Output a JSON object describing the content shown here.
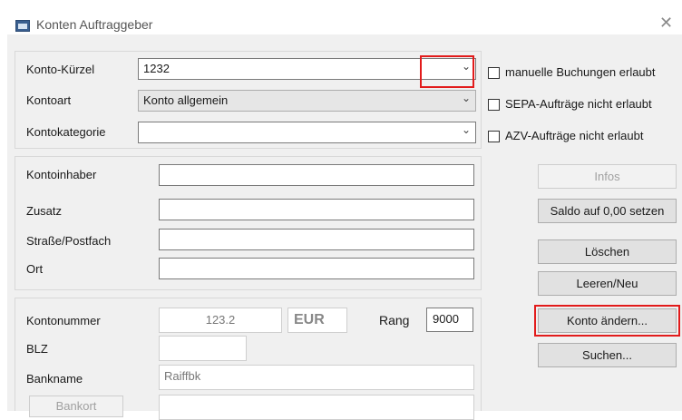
{
  "window": {
    "title": "Konten Auftraggeber",
    "close_glyph": "✕"
  },
  "top": {
    "konto_kuerzel": {
      "label": "Konto-Kürzel",
      "value": "1232"
    },
    "kontoart": {
      "label": "Kontoart",
      "value": "Konto allgemein"
    },
    "kontokategorie": {
      "label": "Kontokategorie",
      "value": ""
    },
    "checkboxes": [
      {
        "label": "manuelle Buchungen erlaubt",
        "checked": false
      },
      {
        "label": "SEPA-Aufträge nicht erlaubt",
        "checked": false
      },
      {
        "label": "AZV-Aufträge nicht erlaubt",
        "checked": false
      }
    ]
  },
  "owner": {
    "kontoinhaber_label": "Kontoinhaber",
    "zusatz_label": "Zusatz",
    "strasse_label": "Straße/Postfach",
    "ort_label": "Ort"
  },
  "account": {
    "kontonummer_label": "Kontonummer",
    "kontonummer_value": "123.2",
    "currency": "EUR",
    "rang_label": "Rang",
    "rang_value": "9000",
    "blz_label": "BLZ",
    "blz_value": "",
    "bankname_label": "Bankname",
    "bankname_value": "Raiffbk",
    "bankort_label": "Bankort"
  },
  "buttons": {
    "infos": "Infos",
    "saldo": "Saldo auf 0,00 setzen",
    "loeschen": "Löschen",
    "leeren": "Leeren/Neu",
    "aendern": "Konto ändern...",
    "suchen": "Suchen..."
  },
  "icons": {
    "dropdown": "chevron-down-icon",
    "app": "window-app-icon",
    "close": "close-icon"
  },
  "colors": {
    "highlight": "#e21b1b",
    "panel": "#f0f0f0"
  }
}
